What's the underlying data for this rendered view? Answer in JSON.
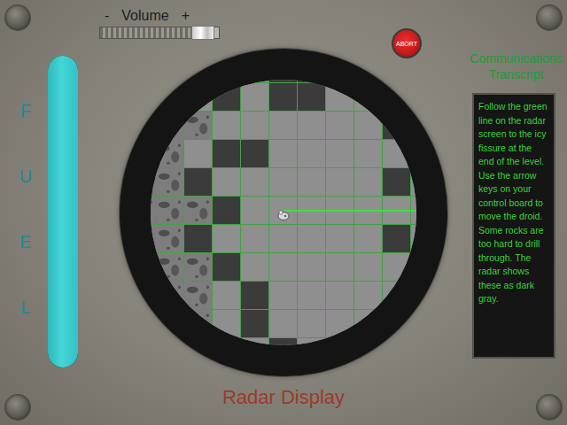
{
  "volume": {
    "minus": "-",
    "label": "Volume",
    "plus": "+",
    "level": 0.8
  },
  "abort": {
    "label": "ABORT"
  },
  "fuel": {
    "letters": [
      "F",
      "U",
      "E",
      "L"
    ],
    "level": 1
  },
  "transcript": {
    "title": "Communications Transcript",
    "text": "Follow the green line on the radar screen to the icy fissure at the end of the level. Use the arrow keys on your control board to move the droid. Some rocks are too hard to drill through. The radar shows these as dark gray."
  },
  "radar": {
    "title": "Radar Display",
    "droid": {
      "row": 5,
      "col": 5
    },
    "guide_line": {
      "visible": true
    },
    "grid": [
      [
        "rubble",
        "rubble",
        "floor",
        "floor",
        "floor",
        "hard",
        "hard",
        "floor",
        "floor",
        "floor",
        "floor"
      ],
      [
        "rubble",
        "rubble",
        "floor",
        "hard",
        "floor",
        "hard",
        "hard",
        "floor",
        "floor",
        "floor",
        "floor"
      ],
      [
        "rubble",
        "rubble",
        "rubble",
        "floor",
        "floor",
        "floor",
        "floor",
        "floor",
        "floor",
        "hard",
        "floor"
      ],
      [
        "rubble",
        "rubble",
        "floor",
        "hard",
        "hard",
        "floor",
        "floor",
        "floor",
        "floor",
        "floor",
        "floor"
      ],
      [
        "rubble",
        "rubble",
        "hard",
        "floor",
        "floor",
        "floor",
        "floor",
        "floor",
        "floor",
        "hard",
        "floor"
      ],
      [
        "rubble",
        "rubble",
        "rubble",
        "hard",
        "floor",
        "floor",
        "floor",
        "floor",
        "floor",
        "floor",
        "floor"
      ],
      [
        "rubble",
        "rubble",
        "hard",
        "floor",
        "floor",
        "floor",
        "floor",
        "floor",
        "floor",
        "hard",
        "floor"
      ],
      [
        "rubble",
        "rubble",
        "rubble",
        "hard",
        "floor",
        "floor",
        "floor",
        "floor",
        "floor",
        "floor",
        "floor"
      ],
      [
        "rubble",
        "rubble",
        "rubble",
        "floor",
        "hard",
        "floor",
        "floor",
        "floor",
        "floor",
        "floor",
        "floor"
      ],
      [
        "rubble",
        "rubble",
        "rubble",
        "floor",
        "hard",
        "floor",
        "floor",
        "floor",
        "floor",
        "floor",
        "floor"
      ],
      [
        "rubble",
        "rubble",
        "floor",
        "floor",
        "floor",
        "hard",
        "floor",
        "floor",
        "floor",
        "floor",
        "floor"
      ]
    ]
  }
}
